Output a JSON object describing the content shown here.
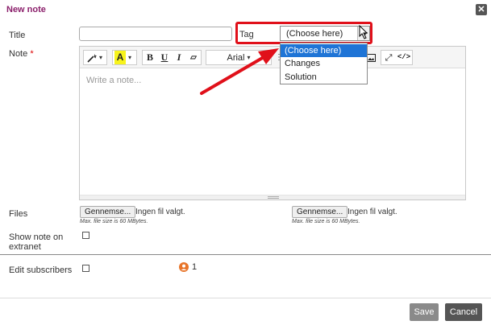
{
  "dialog": {
    "title": "New note"
  },
  "form": {
    "title_label": "Title",
    "note_label": "Note",
    "required_marker": "*",
    "tag_label": "Tag",
    "files_label": "Files",
    "show_note_label_line1": "Show note on",
    "show_note_label_line2": "extranet",
    "edit_subscribers_label": "Edit subscribers",
    "subscribers_count": "1"
  },
  "tag_select": {
    "selected": "(Choose here)",
    "options": [
      "(Choose here)",
      "Changes",
      "Solution"
    ]
  },
  "editor": {
    "font_label": "Arial",
    "placeholder": "Write a note..."
  },
  "files": {
    "browse_label": "Gennemse...",
    "no_file_text": "Ingen fil valgt.",
    "max_size_text": "Max. file size is 60 MBytes."
  },
  "buttons": {
    "save": "Save",
    "cancel": "Cancel"
  },
  "colors": {
    "title": "#8b1f6b",
    "highlight": "#e0101a",
    "selection": "#1e74d6",
    "subscriber_icon": "#e8752a"
  }
}
